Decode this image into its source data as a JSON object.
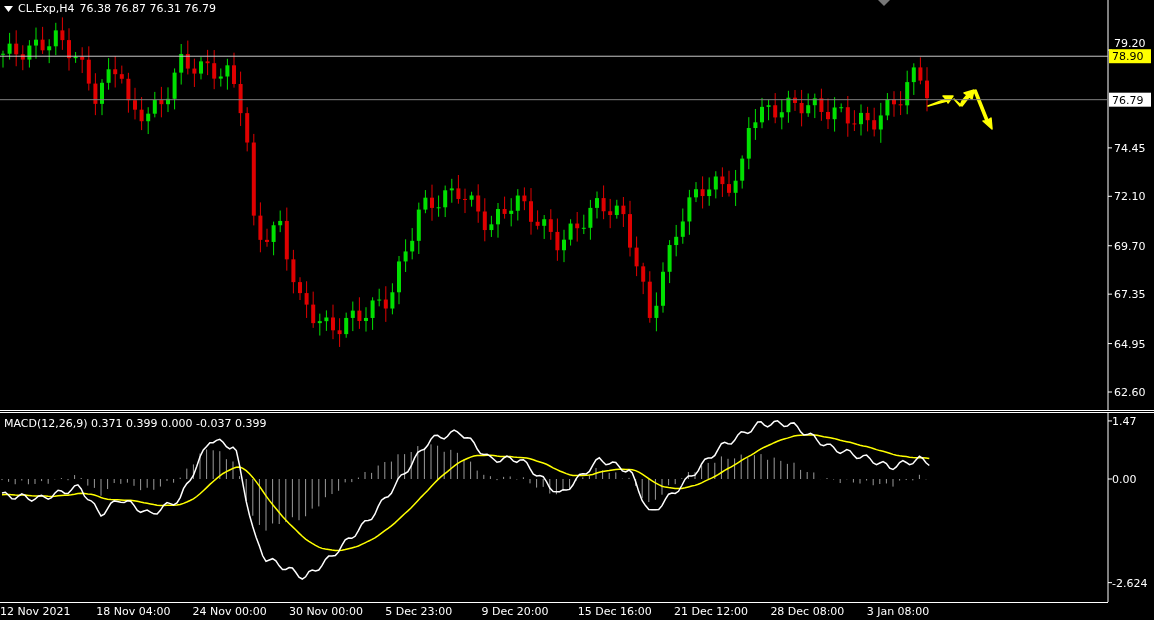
{
  "header": {
    "symbol": "CL.Exp,H4",
    "ohlc": "76.38 76.87 76.31 76.79"
  },
  "price_axis": {
    "ticks": [
      "79.20",
      "74.45",
      "72.10",
      "69.70",
      "67.35",
      "64.95",
      "62.60"
    ]
  },
  "price_labels": [
    {
      "kind": "level-line",
      "text": "78.90"
    },
    {
      "kind": "bid-line",
      "text": "76.79"
    }
  ],
  "macd": {
    "label": "MACD(12,26,9) 0.371 0.399 0.000 -0.037 0.399",
    "ticks": [
      "1.47",
      "0.00",
      "-2.624"
    ]
  },
  "time_axis": {
    "labels": [
      "12 Nov 2021",
      "18 Nov 04:00",
      "24 Nov 00:00",
      "30 Nov 00:00",
      "5 Dec 23:00",
      "9 Dec 20:00",
      "15 Dec 16:00",
      "21 Dec 12:00",
      "28 Dec 08:00",
      "3 Jan 08:00"
    ]
  }
}
